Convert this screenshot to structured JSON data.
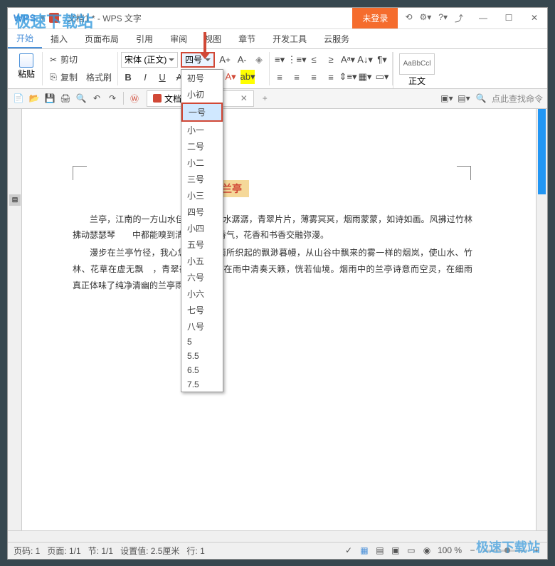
{
  "watermarks": {
    "tl": "极速下载站",
    "br": "极速下载站"
  },
  "titlebar": {
    "app_logo": "WPS",
    "doc_title": "文档1 * - WPS 文字",
    "login": "未登录",
    "icons": [
      "gear",
      "help",
      "feedback",
      "share"
    ]
  },
  "menubar": {
    "items": [
      "开始",
      "插入",
      "页面布局",
      "引用",
      "审阅",
      "视图",
      "章节",
      "开发工具",
      "云服务"
    ],
    "active_index": 0
  },
  "ribbon": {
    "paste": "粘贴",
    "cut": "剪切",
    "copy": "复制",
    "format_painter": "格式刷",
    "font_name": "宋体 (正文)",
    "font_size": "四号",
    "bold": "B",
    "italic": "I",
    "underline": "U",
    "strike": "A",
    "style_preview": "AaBbCcl",
    "style_label": "正文"
  },
  "font_sizes": [
    "初号",
    "小初",
    "一号",
    "小一",
    "二号",
    "小二",
    "三号",
    "小三",
    "四号",
    "小四",
    "五号",
    "小五",
    "六号",
    "小六",
    "七号",
    "八号",
    "5",
    "5.5",
    "6.5",
    "7.5"
  ],
  "font_size_highlight_index": 2,
  "quickbar": {
    "doc_tab": "文档1 *",
    "search_placeholder": "点此查找命令"
  },
  "document": {
    "title": "兰亭",
    "paragraphs": [
      "兰亭，江南的一方山水佳境，　　溪水潺潺，青翠片片，薄雾冥冥，烟雨蒙蒙，如诗如画。风拂过竹林拂动瑟瑟琴　　中都能嗅到清新湿润的香气，花香和书香交融弥漫。",
      "漫步在兰亭竹径，我心悠然。　　雨所织起的飘渺暮幔，从山谷中飘来的雾一样的烟岚，使山水、竹林、花草在虚无飘　，青翠欲滴的竹林在雨中清奏天籁，恍若仙境。烟雨中的兰亭诗意而空灵，在细雨　　真正体味了纯净清幽的兰亭雨榭。"
    ]
  },
  "statusbar": {
    "page": "页码: 1",
    "pages": "页面: 1/1",
    "sections": "节: 1/1",
    "setting": "设置值: 2.5厘米",
    "line": "行: 1",
    "zoom": "100 %"
  }
}
